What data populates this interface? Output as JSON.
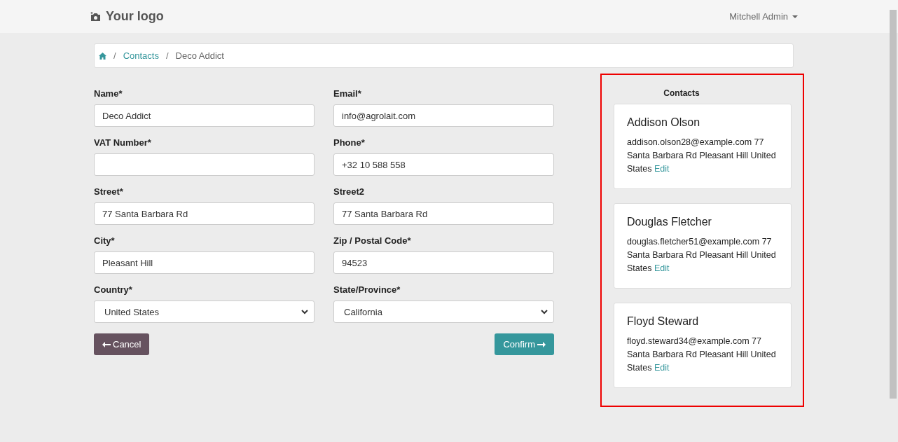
{
  "header": {
    "logo": "Your logo",
    "user_menu": "Mitchell Admin"
  },
  "breadcrumb": [
    {
      "separator": "/",
      "label": "Contacts",
      "kind": "link"
    },
    {
      "separator": "/",
      "label": "Deco Addict",
      "kind": "current"
    }
  ],
  "form": {
    "fields": [
      {
        "label": "Name*",
        "kind": "input",
        "value": "Deco Addict"
      },
      {
        "label": "Email*",
        "kind": "input",
        "value": "info@agrolait.com"
      },
      {
        "label": "VAT Number*",
        "kind": "input"
      },
      {
        "label": "Phone*",
        "kind": "input",
        "value": "+32 10 588 558"
      },
      {
        "label": "Street*",
        "kind": "input",
        "value": "77 Santa Barbara Rd"
      },
      {
        "label": "Street2",
        "kind": "input",
        "value": "77 Santa Barbara Rd"
      },
      {
        "label": "City*",
        "kind": "input",
        "value": "Pleasant Hill"
      },
      {
        "label": "Zip / Postal Code*",
        "kind": "input",
        "value": "94523"
      },
      {
        "label": "Country*",
        "kind": "select",
        "value": "United States"
      },
      {
        "label": "State/Province*",
        "kind": "select",
        "value": "California"
      }
    ],
    "cancel_button": "Cancel",
    "confirm_button": "Confirm"
  },
  "contacts_panel": {
    "title": "Contacts",
    "highlighted": true,
    "contacts": [
      {
        "name": "Addison Olson",
        "details": "addison.olson28@example.com 77 Santa Barbara Rd Pleasant Hill United States",
        "link": "Edit"
      },
      {
        "name": "Douglas Fletcher",
        "details": "douglas.fletcher51@example.com 77 Santa Barbara Rd Pleasant Hill United States",
        "link": "Edit"
      },
      {
        "name": "Floyd Steward",
        "details": "floyd.steward34@example.com 77 Santa Barbara Rd Pleasant Hill United States",
        "link": "Edit"
      }
    ]
  }
}
